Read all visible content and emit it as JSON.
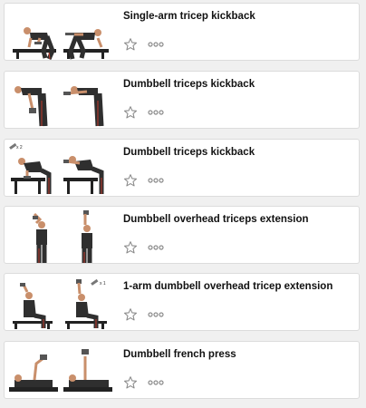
{
  "exercises": [
    {
      "title": "Single-arm tricep kickback",
      "pose": "kickback-bench",
      "icon": "star-outline-icon"
    },
    {
      "title": "Dumbbell triceps kickback",
      "pose": "kickback-standing",
      "icon": "star-outline-icon"
    },
    {
      "title": "Dumbbell triceps kickback",
      "pose": "kickback-seated",
      "badge": "x 2",
      "icon": "star-outline-icon"
    },
    {
      "title": "Dumbbell overhead triceps extension",
      "pose": "overhead-standing",
      "icon": "star-outline-icon"
    },
    {
      "title": "1-arm dumbbell overhead tricep extension",
      "pose": "overhead-seated",
      "badge": "x 1",
      "icon": "star-outline-icon"
    },
    {
      "title": "Dumbbell french press",
      "pose": "lying-press",
      "icon": "star-outline-icon"
    }
  ],
  "colors": {
    "title": "#111111",
    "icon": "#8a8a8a",
    "figure_shirt": "#2f2f2f",
    "figure_pants_stripe": "#c0392b",
    "skin": "#c98f6b",
    "bench": "#222222"
  }
}
